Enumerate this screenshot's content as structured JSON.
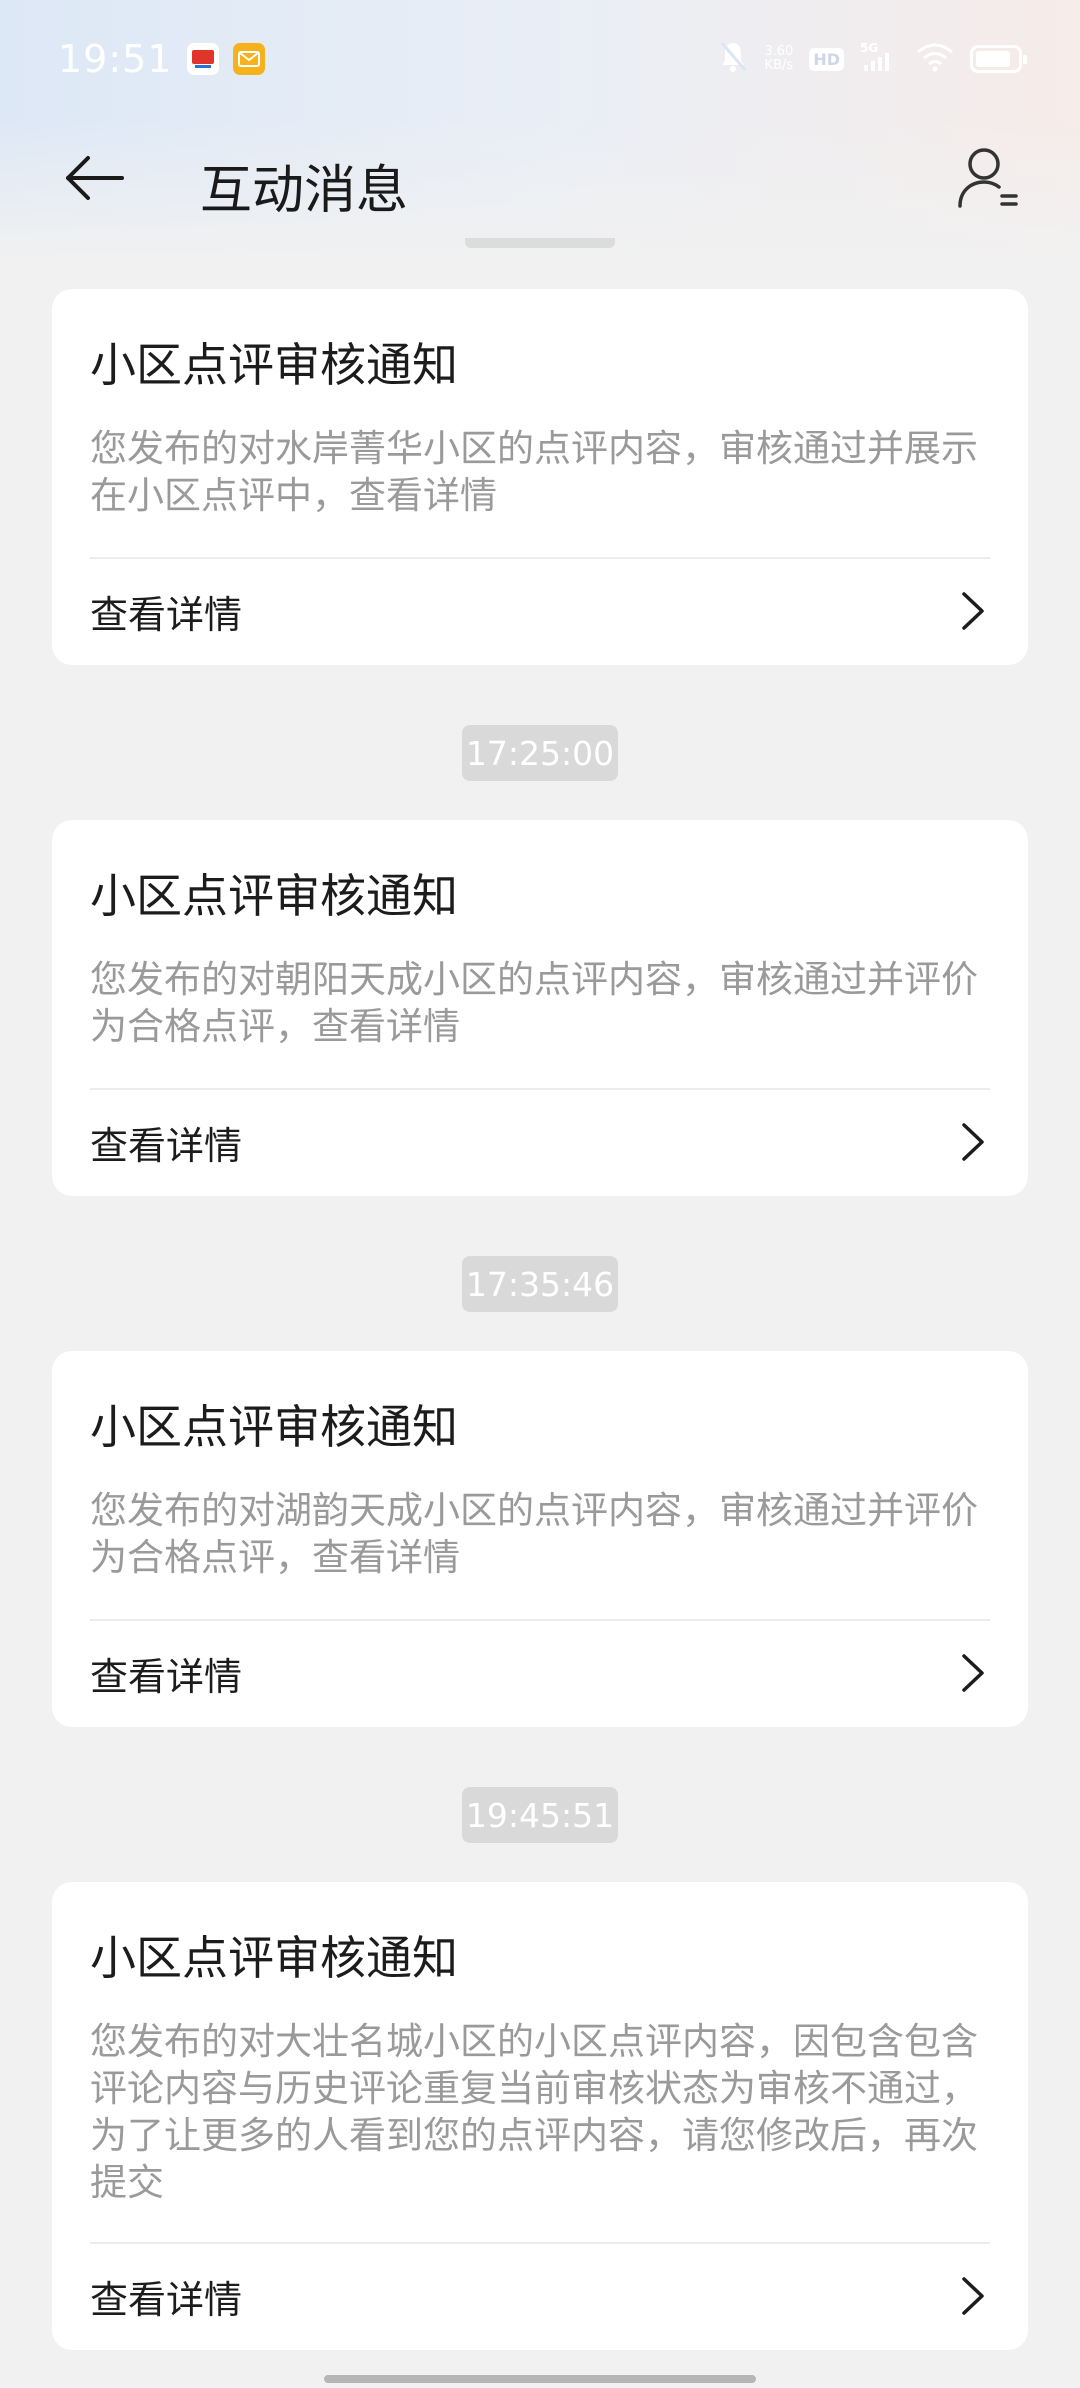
{
  "status_bar": {
    "time": "19:51",
    "net_speed": "3.60\nKB/s",
    "hd": "HD",
    "network": "5G"
  },
  "header": {
    "title": "互动消息"
  },
  "messages": [
    {
      "time": "",
      "title": "小区点评审核通知",
      "body": "您发布的对水岸菁华小区的点评内容，审核通过并展示在小区点评中，查看详情",
      "link": "查看详情"
    },
    {
      "time": "17:25:00",
      "title": "小区点评审核通知",
      "body": "您发布的对朝阳天成小区的点评内容，审核通过并评价为合格点评，查看详情",
      "link": "查看详情"
    },
    {
      "time": "17:35:46",
      "title": "小区点评审核通知",
      "body": "您发布的对湖韵天成小区的点评内容，审核通过并评价为合格点评，查看详情",
      "link": "查看详情"
    },
    {
      "time": "19:45:51",
      "title": "小区点评审核通知",
      "body": "您发布的对大壮名城小区的小区点评内容，因包含包含评论内容与历史评论重复当前审核状态为审核不通过，为了让更多的人看到您的点评内容，请您修改后，再次提交",
      "link": "查看详情"
    }
  ],
  "icons": {
    "back": "arrow-left-icon",
    "user": "user-list-icon",
    "chevron": "chevron-right-icon"
  },
  "colors": {
    "background": "#f1f1f1",
    "card": "#ffffff",
    "title_text": "#1c1c1c",
    "body_text": "#9a9a9a",
    "time_chip": "#d9d9d9"
  }
}
